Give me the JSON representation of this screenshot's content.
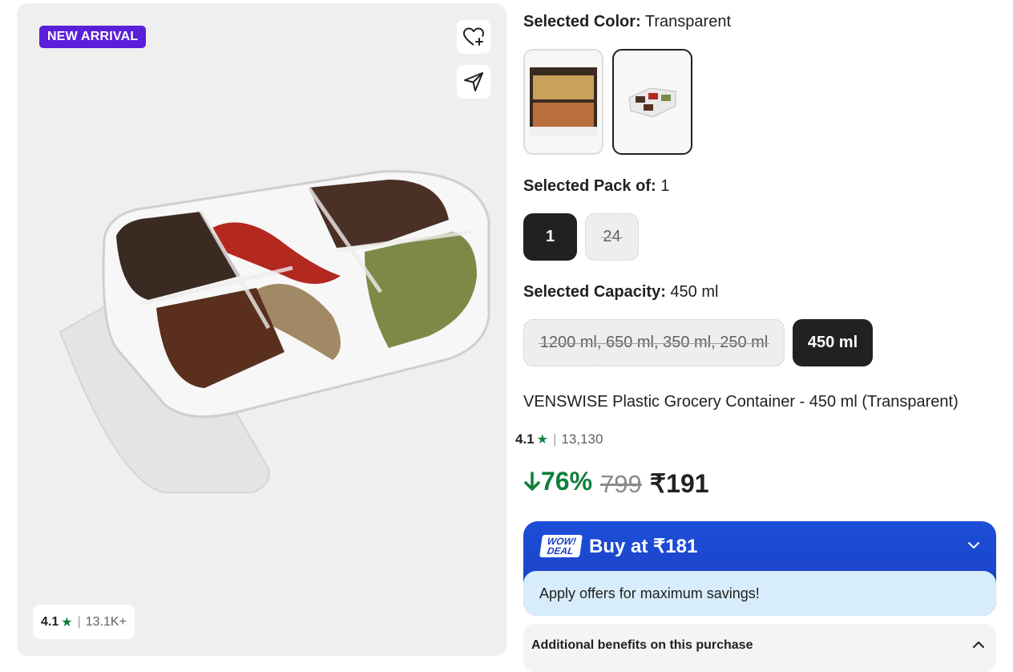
{
  "gallery": {
    "badge": "NEW ARRIVAL",
    "wishlist_icon": "heart-plus-icon",
    "share_icon": "paper-plane-icon",
    "rating": {
      "value": "4.1",
      "count": "13.1K+"
    }
  },
  "color": {
    "label": "Selected Color:",
    "value": "Transparent"
  },
  "pack": {
    "label": "Selected Pack of:",
    "value": "1",
    "options": [
      "1",
      "24"
    ]
  },
  "capacity": {
    "label": "Selected Capacity:",
    "value": "450 ml",
    "options": [
      "1200 ml, 650 ml, 350 ml, 250 ml",
      "450 ml"
    ]
  },
  "product": {
    "title": "VENSWISE Plastic Grocery Container  - 450 ml (Transparent)",
    "rating": {
      "value": "4.1",
      "count": "13,130"
    },
    "discount": "76%",
    "mrp": "799",
    "price": "₹191"
  },
  "deal": {
    "badge_line1": "WOW!",
    "badge_line2": "DEAL",
    "buy_label": "Buy at ₹181",
    "offers_text": "Apply offers for maximum savings!"
  },
  "benefits": {
    "label": "Additional benefits on this purchase"
  },
  "colors": {
    "brand_purple": "#5b1ed9",
    "deal_blue": "#1d4ed8",
    "green": "#0f7f3a",
    "selected": "#212121"
  }
}
